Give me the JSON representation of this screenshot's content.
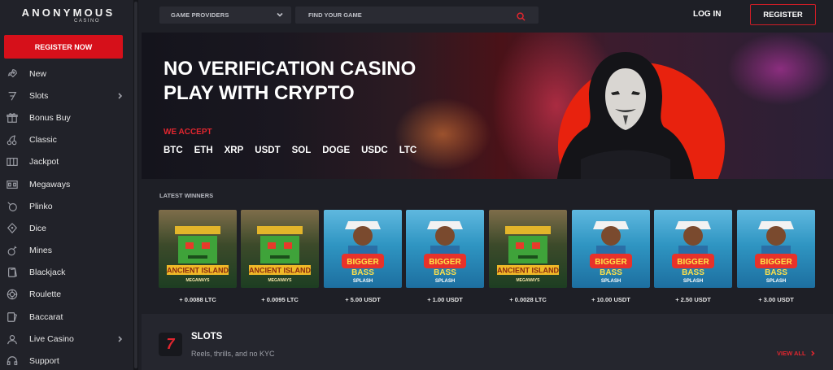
{
  "brand": {
    "name": "ANONYMOUS",
    "sub": "CASINO"
  },
  "sidebar": {
    "register_label": "REGISTER NOW",
    "items": [
      {
        "label": "New",
        "icon": "rocket-icon"
      },
      {
        "label": "Slots",
        "icon": "seven-icon",
        "has_submenu": true
      },
      {
        "label": "Bonus Buy",
        "icon": "gift-icon"
      },
      {
        "label": "Classic",
        "icon": "cherries-icon"
      },
      {
        "label": "Jackpot",
        "icon": "jackpot-icon"
      },
      {
        "label": "Megaways",
        "icon": "megaways-icon"
      },
      {
        "label": "Plinko",
        "icon": "plinko-icon"
      },
      {
        "label": "Dice",
        "icon": "dice-icon"
      },
      {
        "label": "Mines",
        "icon": "bomb-icon"
      },
      {
        "label": "Blackjack",
        "icon": "cards-icon"
      },
      {
        "label": "Roulette",
        "icon": "roulette-icon"
      },
      {
        "label": "Baccarat",
        "icon": "baccarat-icon"
      },
      {
        "label": "Live Casino",
        "icon": "live-icon",
        "has_submenu": true
      },
      {
        "label": "Support",
        "icon": "headset-icon"
      }
    ]
  },
  "topbar": {
    "providers_label": "GAME PROVIDERS",
    "search_placeholder": "FIND YOUR GAME",
    "login_label": "LOG IN",
    "register_label": "REGISTER"
  },
  "hero": {
    "title_line1": "NO VERIFICATION CASINO",
    "title_line2": "PLAY WITH CRYPTO",
    "accept_label": "WE ACCEPT",
    "coins": [
      "BTC",
      "ETH",
      "XRP",
      "USDT",
      "SOL",
      "DOGE",
      "USDC",
      "LTC"
    ]
  },
  "latest_winners": {
    "title": "LATEST WINNERS",
    "items": [
      {
        "game": "Ancient Island Megaways",
        "amount": "+ 0.0088 LTC"
      },
      {
        "game": "Ancient Island Megaways",
        "amount": "+ 0.0095 LTC"
      },
      {
        "game": "Bigger Bass Splash",
        "amount": "+ 5.00 USDT"
      },
      {
        "game": "Bigger Bass Splash",
        "amount": "+ 1.00 USDT"
      },
      {
        "game": "Ancient Island Megaways",
        "amount": "+ 0.0028 LTC"
      },
      {
        "game": "Bigger Bass Splash",
        "amount": "+ 10.00 USDT"
      },
      {
        "game": "Bigger Bass Splash",
        "amount": "+ 2.50 USDT"
      },
      {
        "game": "Bigger Bass Splash",
        "amount": "+ 3.00 USDT"
      }
    ]
  },
  "slots_section": {
    "title": "SLOTS",
    "subtitle": "Reels, thrills, and no KYC",
    "view_all_label": "VIEW ALL"
  },
  "colors": {
    "accent": "#e2262f",
    "register_bg": "#d6101a",
    "background": "#1e1f26",
    "sidebar": "#212229"
  }
}
